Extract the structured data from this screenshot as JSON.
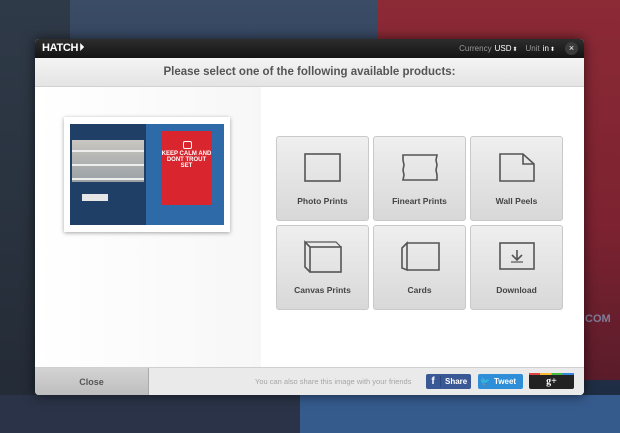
{
  "app": {
    "logo": "HATCH"
  },
  "topbar": {
    "currency_label": "Currency",
    "currency_value": "USD",
    "unit_label": "Unit",
    "unit_value": "in",
    "close_symbol": "×"
  },
  "heading": "Please select one of the following available products:",
  "preview": {
    "poster_text": "KEEP CALM AND DONT TROUT SET"
  },
  "products": [
    {
      "label": "Photo Prints",
      "icon": "photo-print-icon"
    },
    {
      "label": "Fineart Prints",
      "icon": "fineart-print-icon"
    },
    {
      "label": "Wall Peels",
      "icon": "wall-peel-icon"
    },
    {
      "label": "Canvas Prints",
      "icon": "canvas-print-icon"
    },
    {
      "label": "Cards",
      "icon": "card-icon"
    },
    {
      "label": "Download",
      "icon": "download-icon"
    }
  ],
  "footer": {
    "close_label": "Close",
    "share_text": "You can also share this image with your friends",
    "facebook_label": "Share",
    "twitter_label": "Tweet",
    "gplus_label": "g+"
  },
  "colors": {
    "facebook": "#3a5896",
    "twitter": "#2f8ed8",
    "poster_red": "#d8252e"
  }
}
